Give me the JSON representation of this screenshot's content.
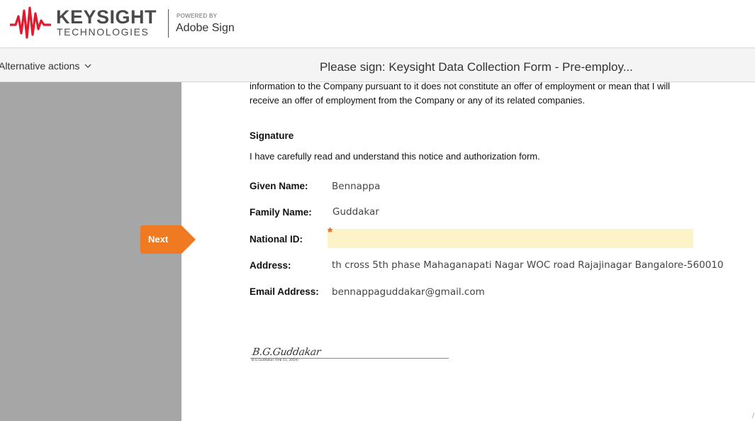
{
  "header": {
    "brand_name": "KEYSIGHT",
    "brand_sub": "TECHNOLOGIES",
    "powered_by": "POWERED BY",
    "product": "Adobe Sign",
    "brand_color": "#e01b2f"
  },
  "toolbar": {
    "alternative_actions_label": "Alternative actions",
    "document_title": "Please sign: Keysight Data Collection Form - Pre-employ..."
  },
  "navigation": {
    "next_label": "Next",
    "next_color": "#f07a22"
  },
  "document": {
    "paragraph_lines": [
      "information to the Company pursuant to it does not constitute an offer of employment or mean that I will",
      "receive an offer of employment from the Company or any of its related companies."
    ],
    "signature_heading": "Signature",
    "acknowledgement": "I have carefully read and understand this notice and authorization form.",
    "fields": {
      "given_name": {
        "label": "Given Name:",
        "value": "Bennappa"
      },
      "family_name": {
        "label": "Family Name:",
        "value": "Guddakar"
      },
      "national_id": {
        "label": "National ID:",
        "value": "",
        "required_marker": "*"
      },
      "address": {
        "label": "Address:",
        "value": "th cross 5th phase Mahaganapati Nagar WOC road Rajajinagar Bangalore-560010"
      },
      "email": {
        "label": "Email Address:",
        "value": "bennappaguddakar@gmail.com"
      }
    },
    "signature": {
      "signed_name": "B.G.Guddakar",
      "caption": "B.G.Guddakar    (Feb 11, 2019)"
    }
  }
}
